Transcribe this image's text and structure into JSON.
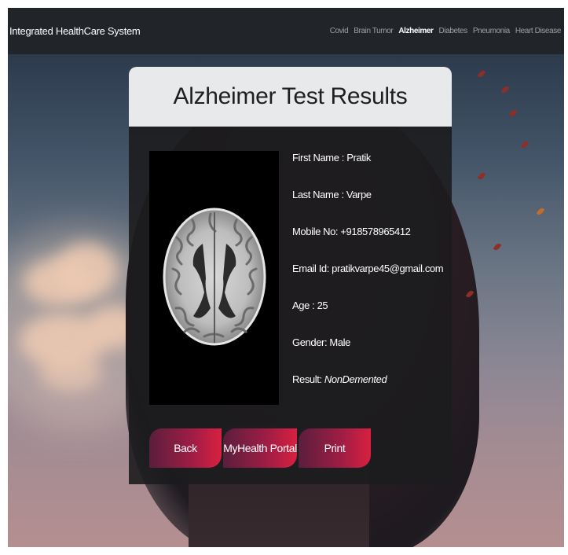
{
  "navbar": {
    "brand": "Integrated HealthCare System",
    "links": [
      {
        "label": "Covid",
        "active": false
      },
      {
        "label": "Brain Tumor",
        "active": false
      },
      {
        "label": "Alzheimer",
        "active": true
      },
      {
        "label": "Diabetes",
        "active": false
      },
      {
        "label": "Pneumonia",
        "active": false
      },
      {
        "label": "Heart Disease",
        "active": false
      }
    ]
  },
  "card": {
    "title": "Alzheimer Test Results",
    "details": {
      "first_name": "First Name : Pratik",
      "last_name": "Last Name : Varpe",
      "mobile": "Mobile No: +918578965412",
      "email": "Email Id: pratikvarpe45@gmail.com",
      "age": "Age : 25",
      "gender": "Gender: Male",
      "result_label": "Result: ",
      "result_value": "NonDemented"
    },
    "buttons": {
      "back": "Back",
      "portal": "MyHealth Portal",
      "print": "Print"
    }
  },
  "colors": {
    "navbar_bg": "#212529",
    "header_bg": "#e8e9eb",
    "button_gradient_start": "#5b1e3c",
    "button_gradient_end": "#d8203f"
  },
  "icons": {
    "scan": "brain-mri-scan"
  }
}
